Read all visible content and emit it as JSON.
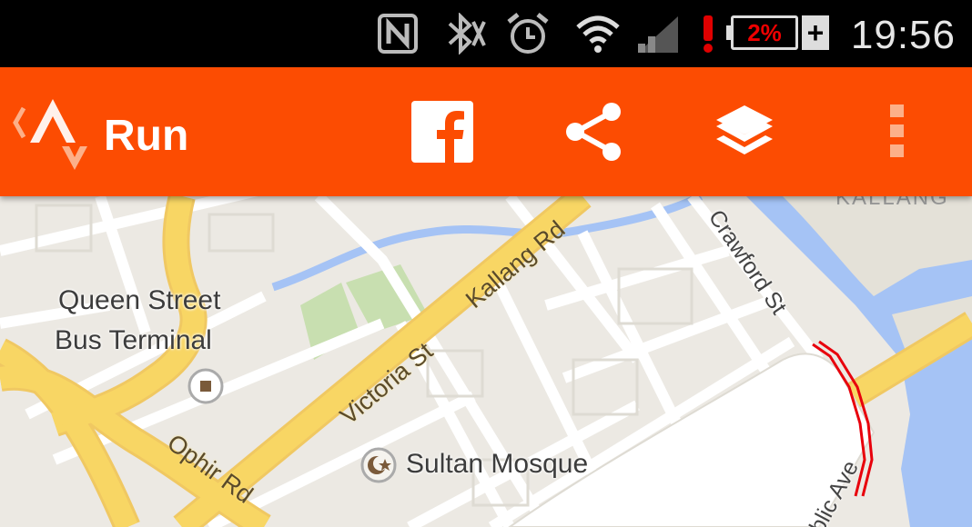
{
  "status_bar": {
    "icons": [
      "nfc-icon",
      "bluetooth-muted-icon",
      "alarm-icon",
      "wifi-icon",
      "signal-icon",
      "battery-alert-icon",
      "battery-icon",
      "charging-icon"
    ],
    "battery_text": "2%",
    "charging_symbol": "+",
    "time": "19:56",
    "alert_color": "#e00000"
  },
  "app_bar": {
    "title": "Run",
    "background": "#fc4c02",
    "actions": [
      "facebook-icon",
      "share-icon",
      "layers-icon",
      "overflow-menu-icon"
    ]
  },
  "map": {
    "places": {
      "bus_terminal_line1": "Queen Street",
      "bus_terminal_line2": "Bus Terminal",
      "mosque": "Sultan Mosque",
      "district": "KALLANG"
    },
    "roads": {
      "kallang": "Kallang Rd",
      "victoria": "Victoria St",
      "ophir": "Ophir Rd",
      "crawford": "Crawford St",
      "republic": "blic Ave"
    },
    "route_color": "#e8000c",
    "water_color": "#a5c3f5",
    "park_color": "#c8dfb0",
    "major_road_color": "#f8d664"
  }
}
